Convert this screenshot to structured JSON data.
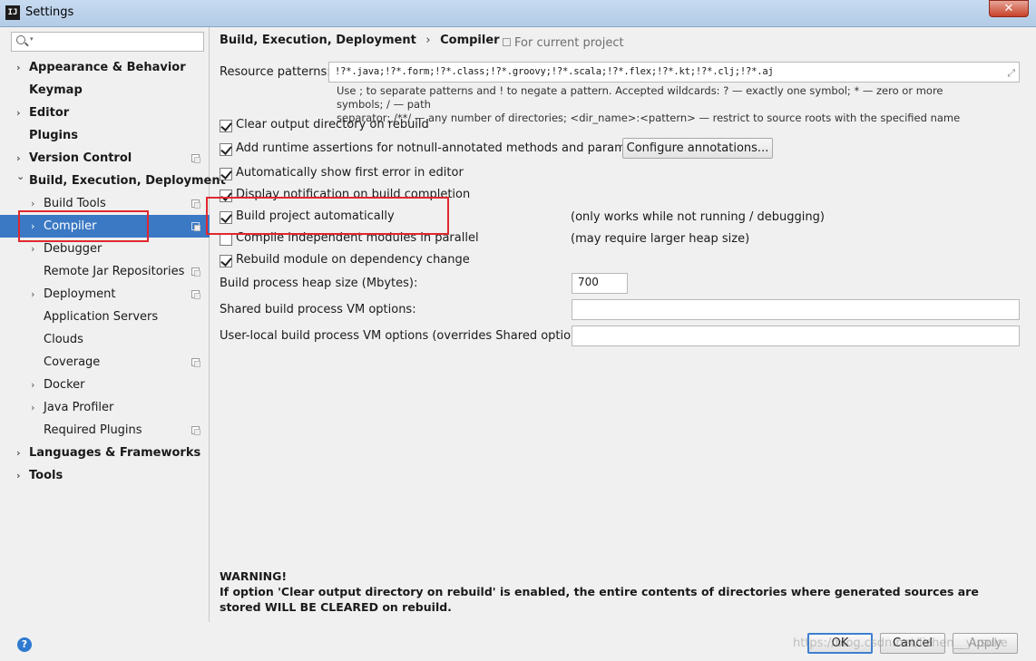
{
  "window": {
    "title": "Settings",
    "app_icon_text": "IJ",
    "close_label": "✕"
  },
  "sidebar": {
    "search_placeholder": "",
    "items": [
      {
        "label": "Appearance & Behavior",
        "bold": true,
        "expandable": true,
        "level": 0,
        "project_icon": false
      },
      {
        "label": "Keymap",
        "bold": true,
        "expandable": false,
        "level": 0,
        "project_icon": false
      },
      {
        "label": "Editor",
        "bold": true,
        "expandable": true,
        "level": 0,
        "project_icon": false
      },
      {
        "label": "Plugins",
        "bold": true,
        "expandable": false,
        "level": 0,
        "project_icon": false
      },
      {
        "label": "Version Control",
        "bold": true,
        "expandable": true,
        "level": 0,
        "project_icon": true
      },
      {
        "label": "Build, Execution, Deployment",
        "bold": true,
        "expanded": true,
        "level": 0,
        "project_icon": false
      },
      {
        "label": "Build Tools",
        "bold": false,
        "expandable": true,
        "level": 1,
        "project_icon": true
      },
      {
        "label": "Compiler",
        "bold": false,
        "expandable": true,
        "level": 1,
        "project_icon": true,
        "selected": true
      },
      {
        "label": "Debugger",
        "bold": false,
        "expandable": true,
        "level": 1,
        "project_icon": false
      },
      {
        "label": "Remote Jar Repositories",
        "bold": false,
        "expandable": false,
        "level": 1,
        "project_icon": true
      },
      {
        "label": "Deployment",
        "bold": false,
        "expandable": true,
        "level": 1,
        "project_icon": true
      },
      {
        "label": "Application Servers",
        "bold": false,
        "expandable": false,
        "level": 1,
        "project_icon": false
      },
      {
        "label": "Clouds",
        "bold": false,
        "expandable": false,
        "level": 1,
        "project_icon": false
      },
      {
        "label": "Coverage",
        "bold": false,
        "expandable": false,
        "level": 1,
        "project_icon": true
      },
      {
        "label": "Docker",
        "bold": false,
        "expandable": true,
        "level": 1,
        "project_icon": false
      },
      {
        "label": "Java Profiler",
        "bold": false,
        "expandable": true,
        "level": 1,
        "project_icon": false
      },
      {
        "label": "Required Plugins",
        "bold": false,
        "expandable": false,
        "level": 1,
        "project_icon": true
      },
      {
        "label": "Languages & Frameworks",
        "bold": true,
        "expandable": true,
        "level": 0,
        "project_icon": false
      },
      {
        "label": "Tools",
        "bold": true,
        "expandable": true,
        "level": 0,
        "project_icon": false
      }
    ]
  },
  "header": {
    "breadcrumb_parent": "Build, Execution, Deployment",
    "breadcrumb_separator": "›",
    "breadcrumb_current": "Compiler",
    "for_current_project": "For current project"
  },
  "compiler": {
    "resource_patterns_label": "Resource patterns:",
    "resource_patterns_value": "!?*.java;!?*.form;!?*.class;!?*.groovy;!?*.scala;!?*.flex;!?*.kt;!?*.clj;!?*.aj",
    "hint_line1": "Use ; to separate patterns and ! to negate a pattern. Accepted wildcards: ? — exactly one symbol; * — zero or more symbols; / — path",
    "hint_line2": "separator; /**/ — any number of directories; <dir_name>:<pattern> — restrict to source roots with the specified name",
    "checkboxes": [
      {
        "label": "Clear output directory on rebuild",
        "checked": true,
        "note": ""
      },
      {
        "label": "Add runtime assertions for notnull-annotated methods and parameters",
        "checked": true,
        "note": ""
      },
      {
        "label": "Automatically show first error in editor",
        "checked": true,
        "note": ""
      },
      {
        "label": "Display notification on build completion",
        "checked": true,
        "note": ""
      },
      {
        "label": "Build project automatically",
        "checked": true,
        "note": "(only works while not running / debugging)"
      },
      {
        "label": "Compile independent modules in parallel",
        "checked": false,
        "note": "(may require larger heap size)"
      },
      {
        "label": "Rebuild module on dependency change",
        "checked": true,
        "note": ""
      }
    ],
    "configure_annotations_label": "Configure annotations...",
    "heap_size_label": "Build process heap size (Mbytes):",
    "heap_size_value": "700",
    "shared_vm_label": "Shared build process VM options:",
    "shared_vm_value": "",
    "user_vm_label": "User-local build process VM options (overrides Shared options):",
    "user_vm_value": ""
  },
  "warning": {
    "title": "WARNING!",
    "text": "If option 'Clear output directory on rebuild' is enabled, the entire contents of directories where generated sources are stored WILL BE CLEARED on rebuild."
  },
  "footer": {
    "help_label": "?",
    "ok_label": "OK",
    "cancel_label": "Cancel",
    "apply_label": "Apply",
    "watermark": "https://blog.csdn.net/lizhen__yusuke"
  },
  "colors": {
    "selection": "#3b79c4",
    "highlight_box": "#e0282e",
    "help_icon": "#2e7ad1"
  }
}
